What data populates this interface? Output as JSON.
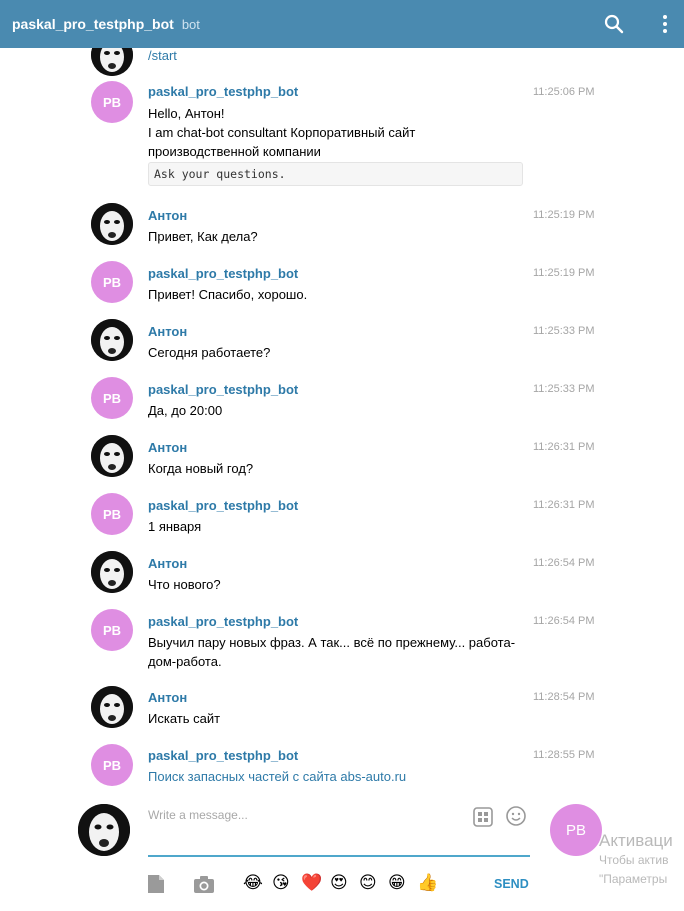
{
  "header": {
    "title": "paskal_pro_testphp_bot",
    "subtitle": "bot",
    "search_icon": "search-icon",
    "more_icon": "more-vertical-icon",
    "background": "#4a8ab0"
  },
  "colors": {
    "accent": "#2e7aa8",
    "bot_avatar": "#df8ee2",
    "time": "#a5a5a5"
  },
  "messages": [
    {
      "sender": "",
      "time": "",
      "lines": [
        "/start"
      ],
      "avatar": "photo"
    },
    {
      "sender": "paskal_pro_testphp_bot",
      "time": "11:25:06 PM",
      "avatar_text": "PB",
      "lines": [
        "Hello, Антон!",
        "I am chat-bot consultant Корпоративный сайт",
        "производственной компании"
      ],
      "code": "Ask your questions."
    },
    {
      "sender": "Антон",
      "time": "11:25:19 PM",
      "lines": [
        "Привет, Как дела?"
      ]
    },
    {
      "sender": "paskal_pro_testphp_bot",
      "time": "11:25:19 PM",
      "avatar_text": "PB",
      "lines": [
        "Привет! Спасибо, хорошо."
      ]
    },
    {
      "sender": "Антон",
      "time": "11:25:33 PM",
      "lines": [
        "Сегодня работаете?"
      ]
    },
    {
      "sender": "paskal_pro_testphp_bot",
      "time": "11:25:33 PM",
      "avatar_text": "PB",
      "lines": [
        "Да, до 20:00"
      ]
    },
    {
      "sender": "Антон",
      "time": "11:26:31 PM",
      "lines": [
        "Когда новый год?"
      ]
    },
    {
      "sender": "paskal_pro_testphp_bot",
      "time": "11:26:31 PM",
      "avatar_text": "PB",
      "lines": [
        "1 января"
      ]
    },
    {
      "sender": "Антон",
      "time": "11:26:54 PM",
      "lines": [
        "Что нового?"
      ]
    },
    {
      "sender": "paskal_pro_testphp_bot",
      "time": "11:26:54 PM",
      "avatar_text": "PB",
      "lines": [
        "Выучил пару новых фраз. А так... всё по прежнему... работа-",
        "дом-работа."
      ]
    },
    {
      "sender": "Антон",
      "time": "11:28:54 PM",
      "lines": [
        "Искать сайт"
      ]
    },
    {
      "sender": "paskal_pro_testphp_bot",
      "time": "11:28:55 PM",
      "avatar_text": "PB",
      "lines": [
        "Поиск запасных частей с сайта abs-auto.ru"
      ]
    }
  ],
  "composer": {
    "placeholder": "Write a message...",
    "commands_icon": "bot-commands-icon",
    "emoji_icon": "smile-icon",
    "peer_avatar_text": "PB",
    "attach_file_icon": "document-icon",
    "attach_photo_icon": "camera-icon",
    "emoji": [
      "😂",
      "😘",
      "❤️",
      "😍",
      "😊",
      "😁",
      "👍"
    ],
    "send_label": "SEND"
  },
  "watermark": {
    "title": "Активаци",
    "line1": "Чтобы актив",
    "line2": "\"Параметры"
  }
}
